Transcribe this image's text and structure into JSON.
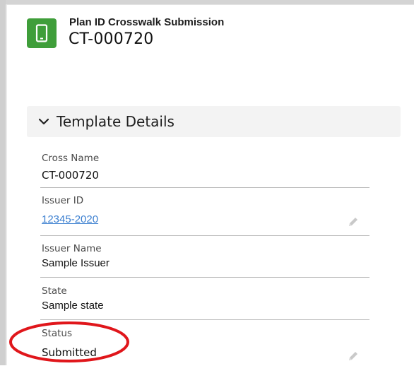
{
  "header": {
    "icon": "mobile-device-icon",
    "subtitle": "Plan ID Crosswalk Submission",
    "title": "CT-000720"
  },
  "section": {
    "title": "Template Details",
    "expanded": true
  },
  "fields": [
    {
      "label": "Cross Name",
      "value": "CT-000720",
      "editable": false
    },
    {
      "label": "Issuer ID",
      "value": "12345-2020",
      "editable": true,
      "is_link": true
    },
    {
      "label": "Issuer Name",
      "value": "Sample Issuer",
      "editable": false
    },
    {
      "label": "State",
      "value": "Sample state",
      "editable": false
    },
    {
      "label": "Status",
      "value": "Submitted",
      "editable": true
    }
  ],
  "annotation": {
    "shape": "ellipse",
    "color": "#e0161b",
    "target": "Status"
  },
  "colors": {
    "icon_bg": "#3f9e3a",
    "link": "#3b7fd0",
    "section_bg": "#f3f3f3"
  }
}
